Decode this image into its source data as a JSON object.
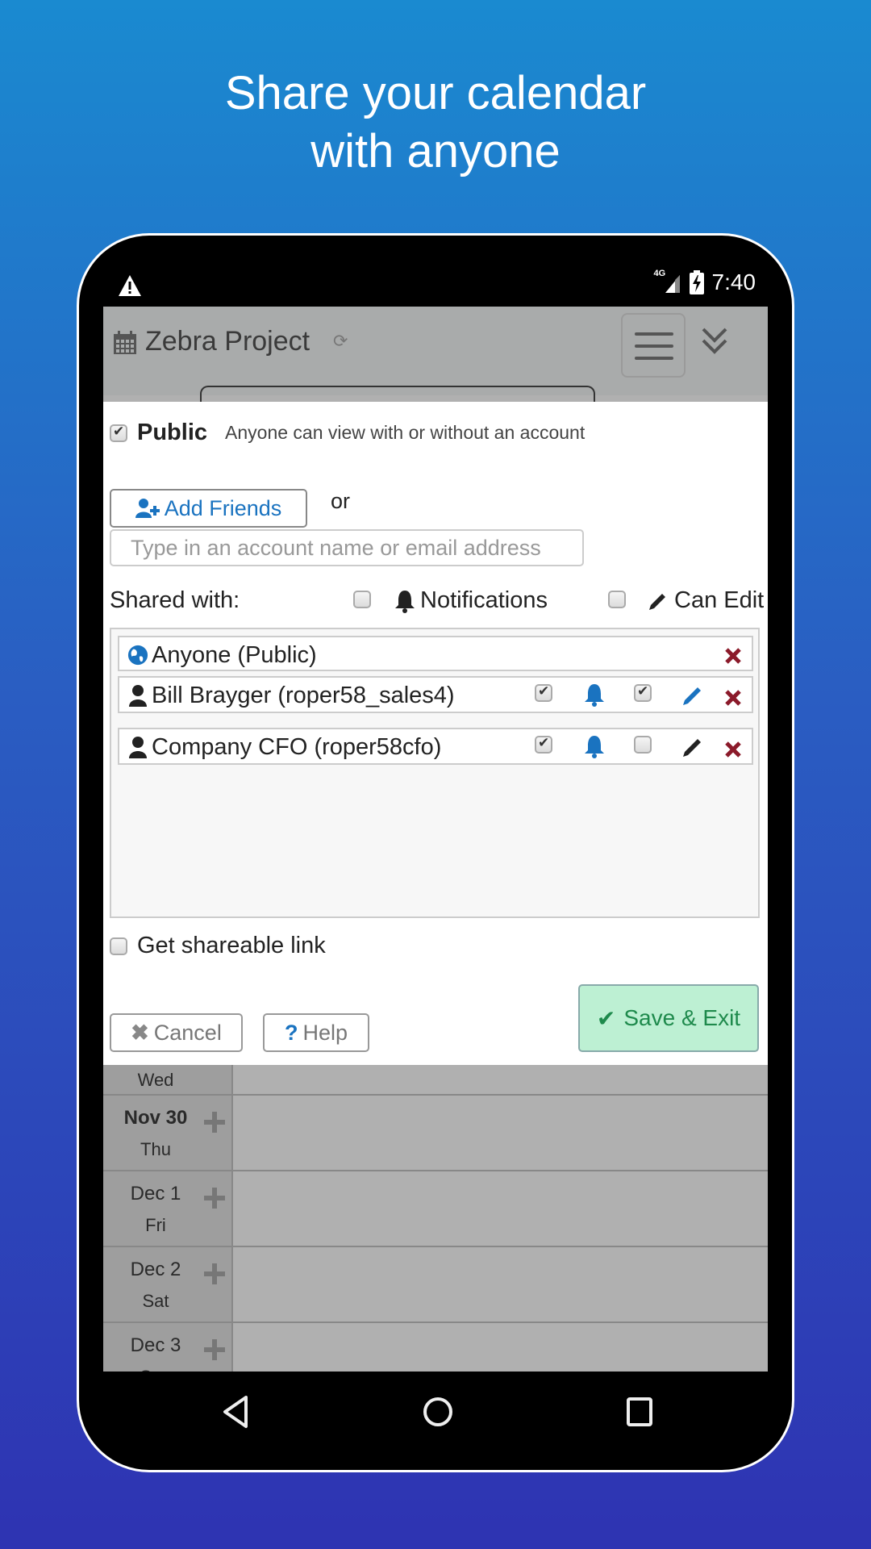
{
  "headline": {
    "line1": "Share your calendar",
    "line2": "with anyone"
  },
  "status_bar": {
    "network": "4G",
    "time": "7:40",
    "icons": [
      "warning-icon",
      "signal-icon",
      "battery-charging-icon"
    ]
  },
  "app_bar": {
    "title": "Zebra Project",
    "icons": [
      "calendar-icon",
      "sync-icon",
      "hamburger-menu-icon",
      "double-chevron-down-icon"
    ]
  },
  "share_dialog": {
    "public": {
      "checked": true,
      "label": "Public",
      "description": "Anyone can view with or without an account"
    },
    "add_friends_label": "Add Friends",
    "or_label": "or",
    "account_input": {
      "value": "",
      "placeholder": "Type in an account name or email address"
    },
    "shared_with_label": "Shared with:",
    "notifications_header": {
      "label": "Notifications",
      "checked": false
    },
    "can_edit_header": {
      "label": "Can Edit",
      "checked": false
    },
    "entries": [
      {
        "name": "Anyone (Public)",
        "type": "public",
        "notifications": null,
        "can_edit": null
      },
      {
        "name": "Bill Brayger (roper58_sales4)",
        "type": "user",
        "notifications": true,
        "can_edit": true
      },
      {
        "name": "Company CFO (roper58cfo)",
        "type": "user",
        "notifications": true,
        "can_edit": false
      }
    ],
    "shareable_link": {
      "label": "Get shareable link",
      "checked": false
    },
    "buttons": {
      "cancel": "Cancel",
      "help": "Help",
      "save": "Save & Exit"
    }
  },
  "calendar": {
    "rows": [
      {
        "date": "",
        "dow": "Wed",
        "today": false
      },
      {
        "date": "Nov 30",
        "dow": "Thu",
        "today": true
      },
      {
        "date": "Dec 1",
        "dow": "Fri",
        "today": false
      },
      {
        "date": "Dec 2",
        "dow": "Sat",
        "today": false
      },
      {
        "date": "Dec 3",
        "dow": "Sun",
        "today": false
      }
    ]
  },
  "colors": {
    "accent_blue": "#1a73c0",
    "remove_red": "#8b1a2a",
    "save_green_bg": "#bdf0d3",
    "save_green_text": "#1e8a4c",
    "bg_gradient_top": "#1a8ad0",
    "bg_gradient_bottom": "#2e33b2"
  }
}
